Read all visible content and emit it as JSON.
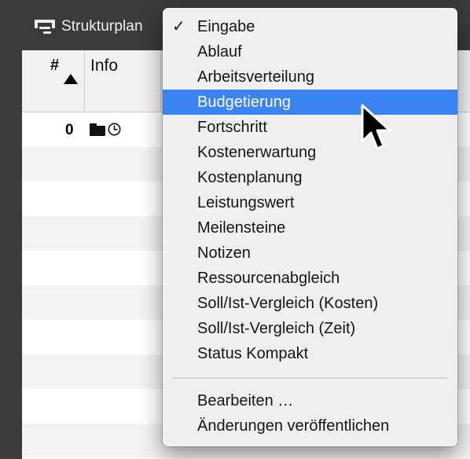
{
  "toolbar": {
    "view_label": "Strukturplan",
    "view_icon": "wbs-icon"
  },
  "table": {
    "columns": [
      {
        "label": "#",
        "sort": "ascending"
      },
      {
        "label": "Info"
      }
    ],
    "rows": [
      {
        "number": "0",
        "icons": [
          "folder-icon",
          "clock-icon"
        ]
      }
    ]
  },
  "menu": {
    "items": [
      {
        "label": "Eingabe",
        "checked": true
      },
      {
        "label": "Ablauf"
      },
      {
        "label": "Arbeitsverteilung"
      },
      {
        "label": "Budgetierung",
        "highlighted": true
      },
      {
        "label": "Fortschritt"
      },
      {
        "label": "Kostenerwartung"
      },
      {
        "label": "Kostenplanung"
      },
      {
        "label": "Leistungswert"
      },
      {
        "label": "Meilensteine"
      },
      {
        "label": "Notizen"
      },
      {
        "label": "Ressourcenabgleich"
      },
      {
        "label": "Soll/Ist-Vergleich (Kosten)"
      },
      {
        "label": "Soll/Ist-Vergleich (Zeit)"
      },
      {
        "label": "Status Kompakt"
      }
    ],
    "footer_items": [
      {
        "label": "Bearbeiten …"
      },
      {
        "label": "Änderungen veröffentlichen"
      }
    ],
    "check_glyph": "✓",
    "highlight_color": "#3b83f2"
  }
}
